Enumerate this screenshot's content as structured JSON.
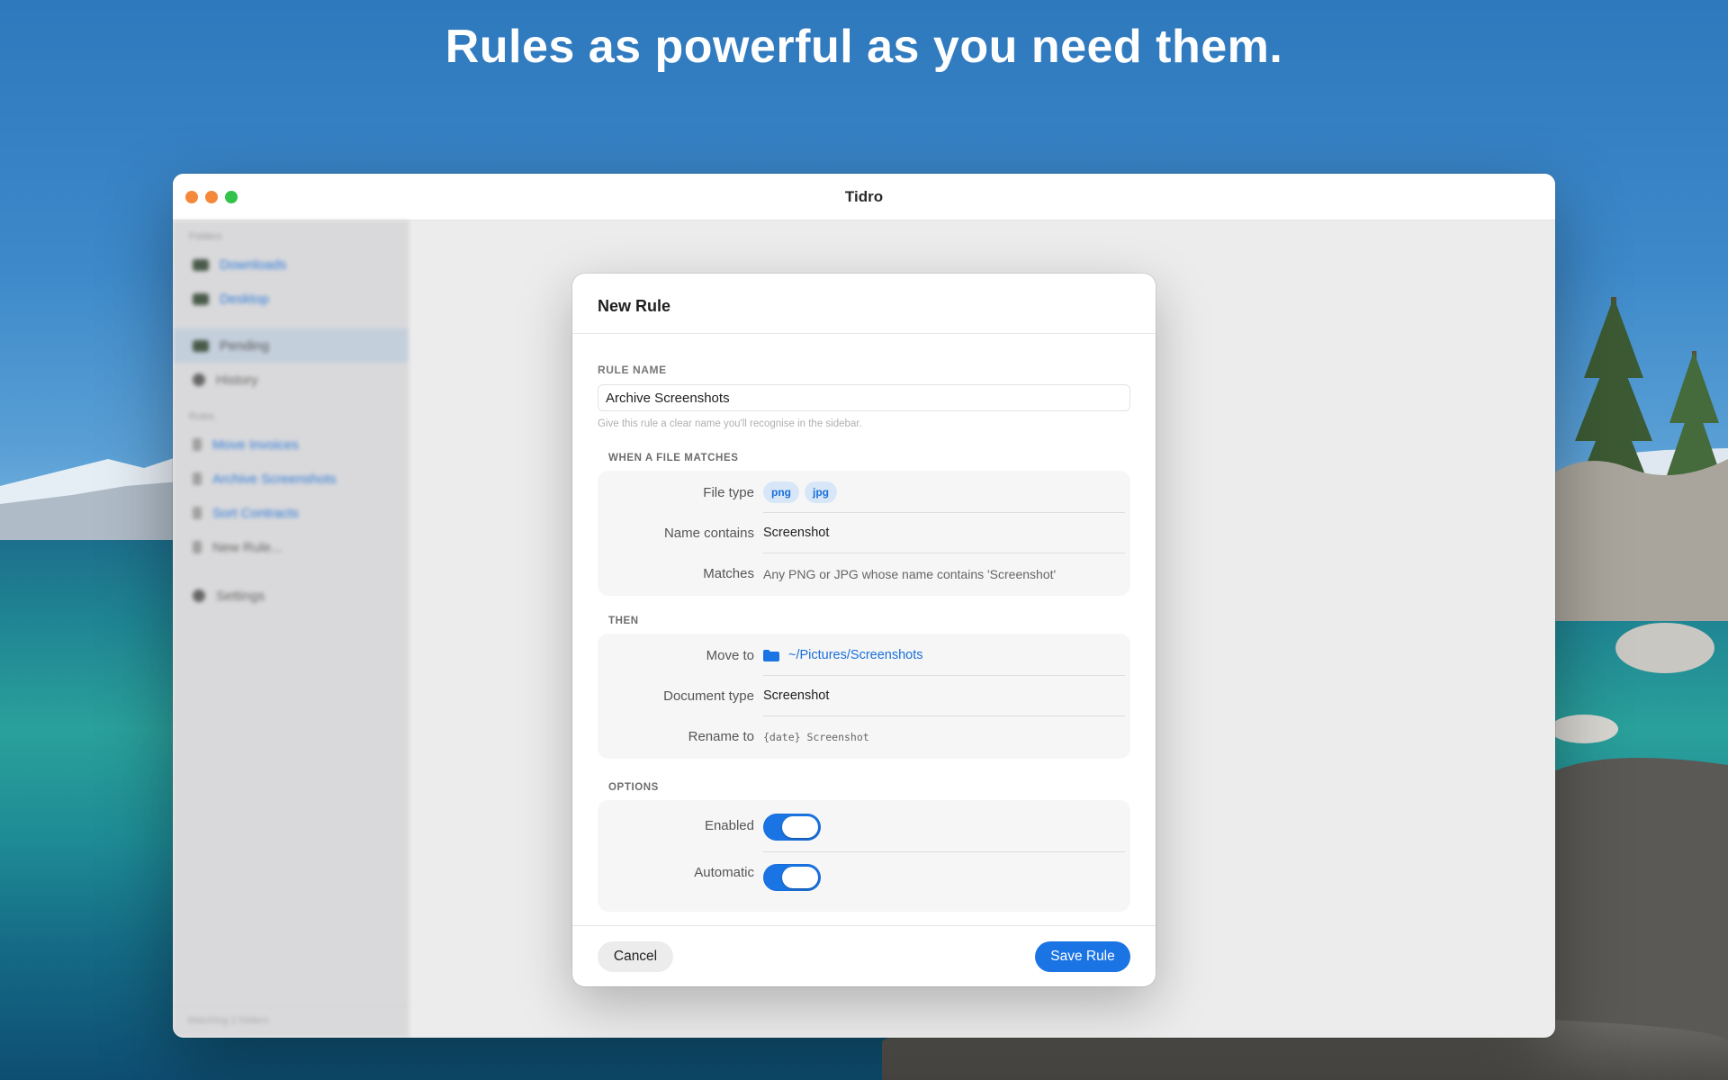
{
  "headline": "Rules as powerful as you need them.",
  "window": {
    "title": "Tidro"
  },
  "sidebar": {
    "section_folders": "Folders",
    "folders": [
      {
        "label": "Downloads",
        "icon": "folder-icon"
      },
      {
        "label": "Desktop",
        "icon": "folder-icon"
      }
    ],
    "nav": [
      {
        "label": "Pending",
        "icon": "inbox-icon"
      },
      {
        "label": "History",
        "icon": "clock-icon"
      }
    ],
    "section_rules": "Rules",
    "rules": [
      {
        "label": "Move Invoices",
        "icon": "rule-icon"
      },
      {
        "label": "Archive Screenshots",
        "icon": "rule-icon"
      },
      {
        "label": "Sort Contracts",
        "icon": "rule-icon"
      }
    ],
    "new_rule": "New Rule...",
    "settings": "Settings",
    "footer": "Watching 2 folders"
  },
  "modal": {
    "title": "New Rule",
    "rule_name_label": "RULE NAME",
    "rule_name_value": "Archive Screenshots",
    "rule_name_hint": "Give this rule a clear name you'll recognise in the sidebar.",
    "when_label": "WHEN A FILE MATCHES",
    "when": {
      "file_type_label": "File type",
      "file_types": [
        "png",
        "jpg"
      ],
      "name_contains_label": "Name contains",
      "name_contains_value": "Screenshot",
      "matches_label": "Matches",
      "matches_value": "Any PNG or JPG whose name contains 'Screenshot'"
    },
    "then_label": "THEN",
    "then": {
      "move_to_label": "Move to",
      "move_to_value": "~/Pictures/Screenshots",
      "doc_type_label": "Document type",
      "doc_type_value": "Screenshot",
      "rename_label": "Rename to",
      "rename_value": "{date} Screenshot"
    },
    "options_label": "OPTIONS",
    "options": {
      "enabled_label": "Enabled",
      "enabled": true,
      "automatic_label": "Automatic",
      "automatic": true
    },
    "cancel_label": "Cancel",
    "save_label": "Save Rule"
  },
  "colors": {
    "accent": "#1a74e4",
    "chip_bg": "#d8e7f8",
    "traffic_close": "#f5883b",
    "traffic_min": "#f5883b",
    "traffic_max": "#33c24a"
  }
}
